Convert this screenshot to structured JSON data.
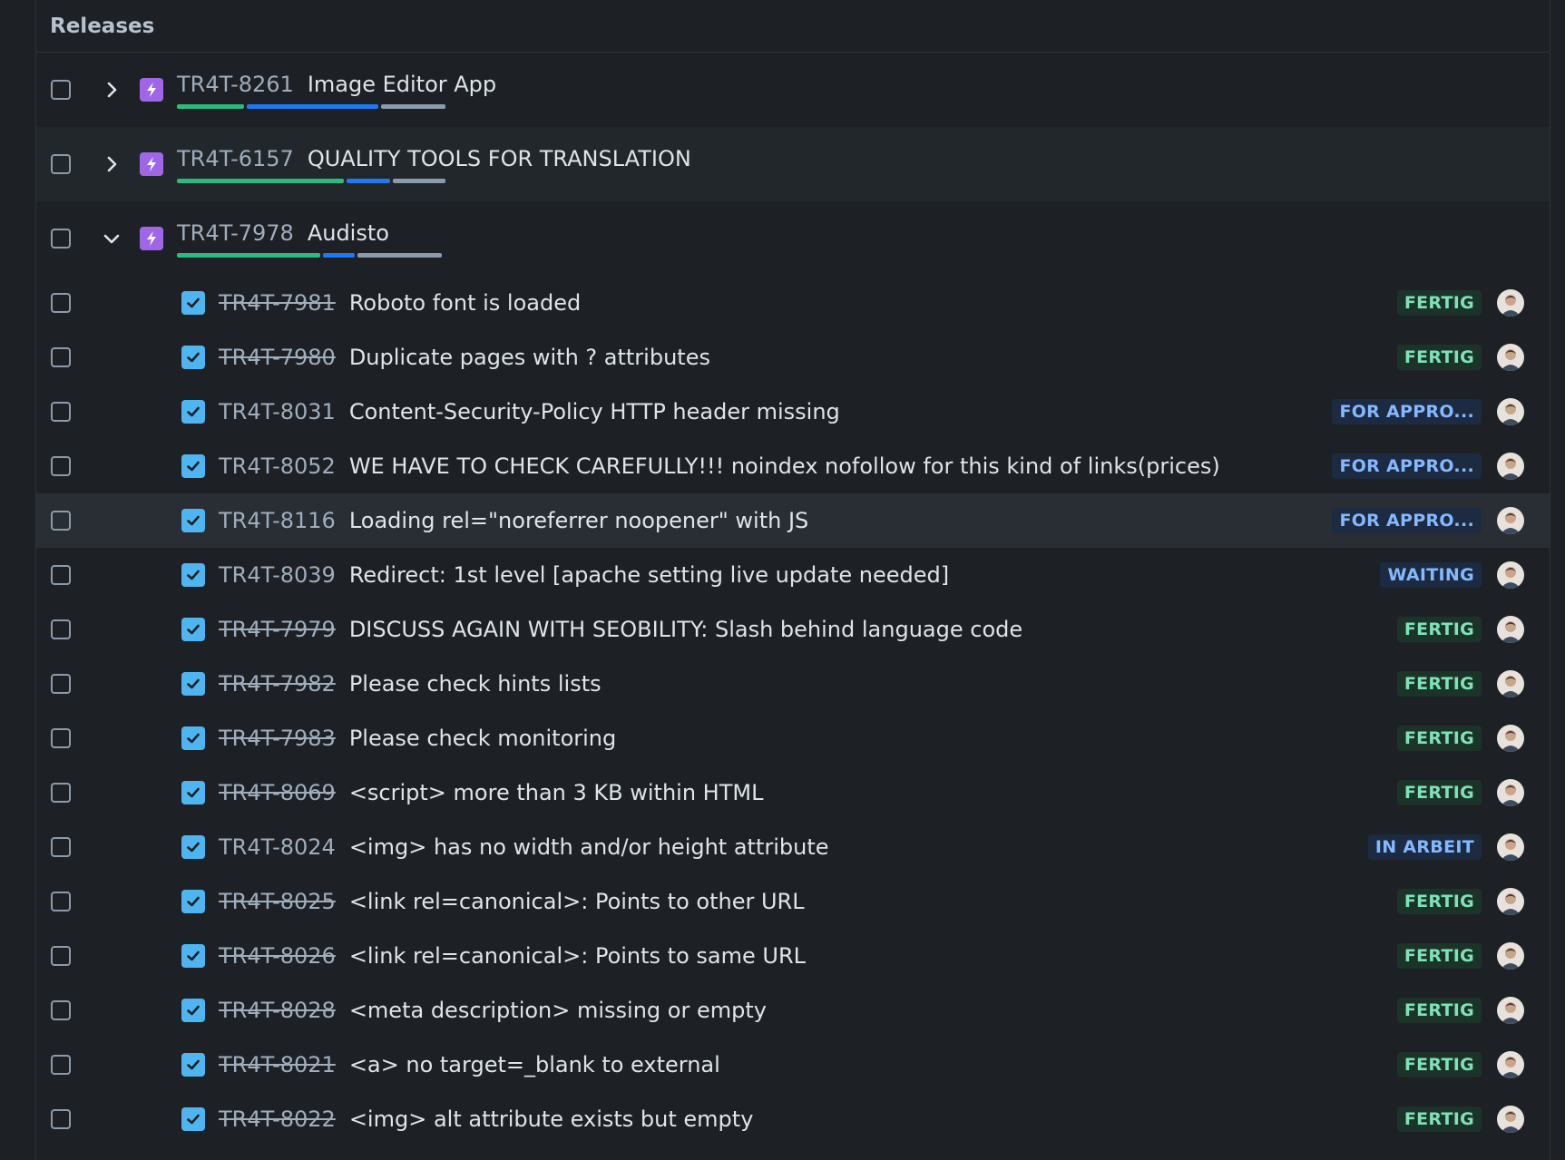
{
  "header": {
    "title": "Releases"
  },
  "epics": [
    {
      "key": "TR4T-8261",
      "title": "Image Editor App",
      "expanded": false,
      "progress": {
        "done": 0.23,
        "in_progress": 0.45,
        "todo": 0.22
      }
    },
    {
      "key": "TR4T-6157",
      "title": "QUALITY TOOLS FOR TRANSLATION",
      "expanded": false,
      "progress": {
        "done": 0.57,
        "in_progress": 0.15,
        "todo": 0.18
      }
    },
    {
      "key": "TR4T-7978",
      "title": "Audisto",
      "expanded": true,
      "progress": {
        "done": 0.49,
        "in_progress": 0.11,
        "todo": 0.29
      }
    }
  ],
  "children": [
    {
      "key": "TR4T-7981",
      "title": "Roboto font is loaded",
      "done": true,
      "status": "FERTIG",
      "status_kind": "done"
    },
    {
      "key": "TR4T-7980",
      "title": "Duplicate pages with ? attributes",
      "done": true,
      "status": "FERTIG",
      "status_kind": "done"
    },
    {
      "key": "TR4T-8031",
      "title": "Content-Security-Policy HTTP header missing",
      "done": false,
      "status": "FOR APPRO...",
      "status_kind": "approve"
    },
    {
      "key": "TR4T-8052",
      "title": "WE HAVE TO CHECK CAREFULLY!!! noindex nofollow for this kind of links(prices)",
      "done": false,
      "status": "FOR APPRO...",
      "status_kind": "approve"
    },
    {
      "key": "TR4T-8116",
      "title": "Loading rel=\"noreferrer noopener\" with JS",
      "done": false,
      "status": "FOR APPRO...",
      "status_kind": "approve"
    },
    {
      "key": "TR4T-8039",
      "title": "Redirect: 1st level [apache setting live update needed]",
      "done": false,
      "status": "WAITING",
      "status_kind": "waiting"
    },
    {
      "key": "TR4T-7979",
      "title": "DISCUSS AGAIN WITH SEOBILITY: Slash behind language code",
      "done": true,
      "status": "FERTIG",
      "status_kind": "done"
    },
    {
      "key": "TR4T-7982",
      "title": "Please check hints lists",
      "done": true,
      "status": "FERTIG",
      "status_kind": "done"
    },
    {
      "key": "TR4T-7983",
      "title": "Please check monitoring",
      "done": true,
      "status": "FERTIG",
      "status_kind": "done"
    },
    {
      "key": "TR4T-8069",
      "title": "<script> more than 3 KB within HTML",
      "done": true,
      "status": "FERTIG",
      "status_kind": "done"
    },
    {
      "key": "TR4T-8024",
      "title": "<img> has no width and/or height attribute",
      "done": false,
      "status": "IN ARBEIT",
      "status_kind": "progress"
    },
    {
      "key": "TR4T-8025",
      "title": "<link rel=canonical>: Points to other URL",
      "done": true,
      "status": "FERTIG",
      "status_kind": "done"
    },
    {
      "key": "TR4T-8026",
      "title": "<link rel=canonical>: Points to same URL",
      "done": true,
      "status": "FERTIG",
      "status_kind": "done"
    },
    {
      "key": "TR4T-8028",
      "title": "<meta description> missing or empty",
      "done": true,
      "status": "FERTIG",
      "status_kind": "done"
    },
    {
      "key": "TR4T-8021",
      "title": "<a> no target=_blank to external",
      "done": true,
      "status": "FERTIG",
      "status_kind": "done"
    },
    {
      "key": "TR4T-8022",
      "title": "<img> alt attribute exists but empty",
      "done": true,
      "status": "FERTIG",
      "status_kind": "done"
    }
  ],
  "hover_row_index": 4,
  "icons": {
    "epic": "lightning-icon",
    "collapsed": "chevron-right-icon",
    "expanded": "chevron-down-icon",
    "checked": "checkbox-checked-icon"
  }
}
